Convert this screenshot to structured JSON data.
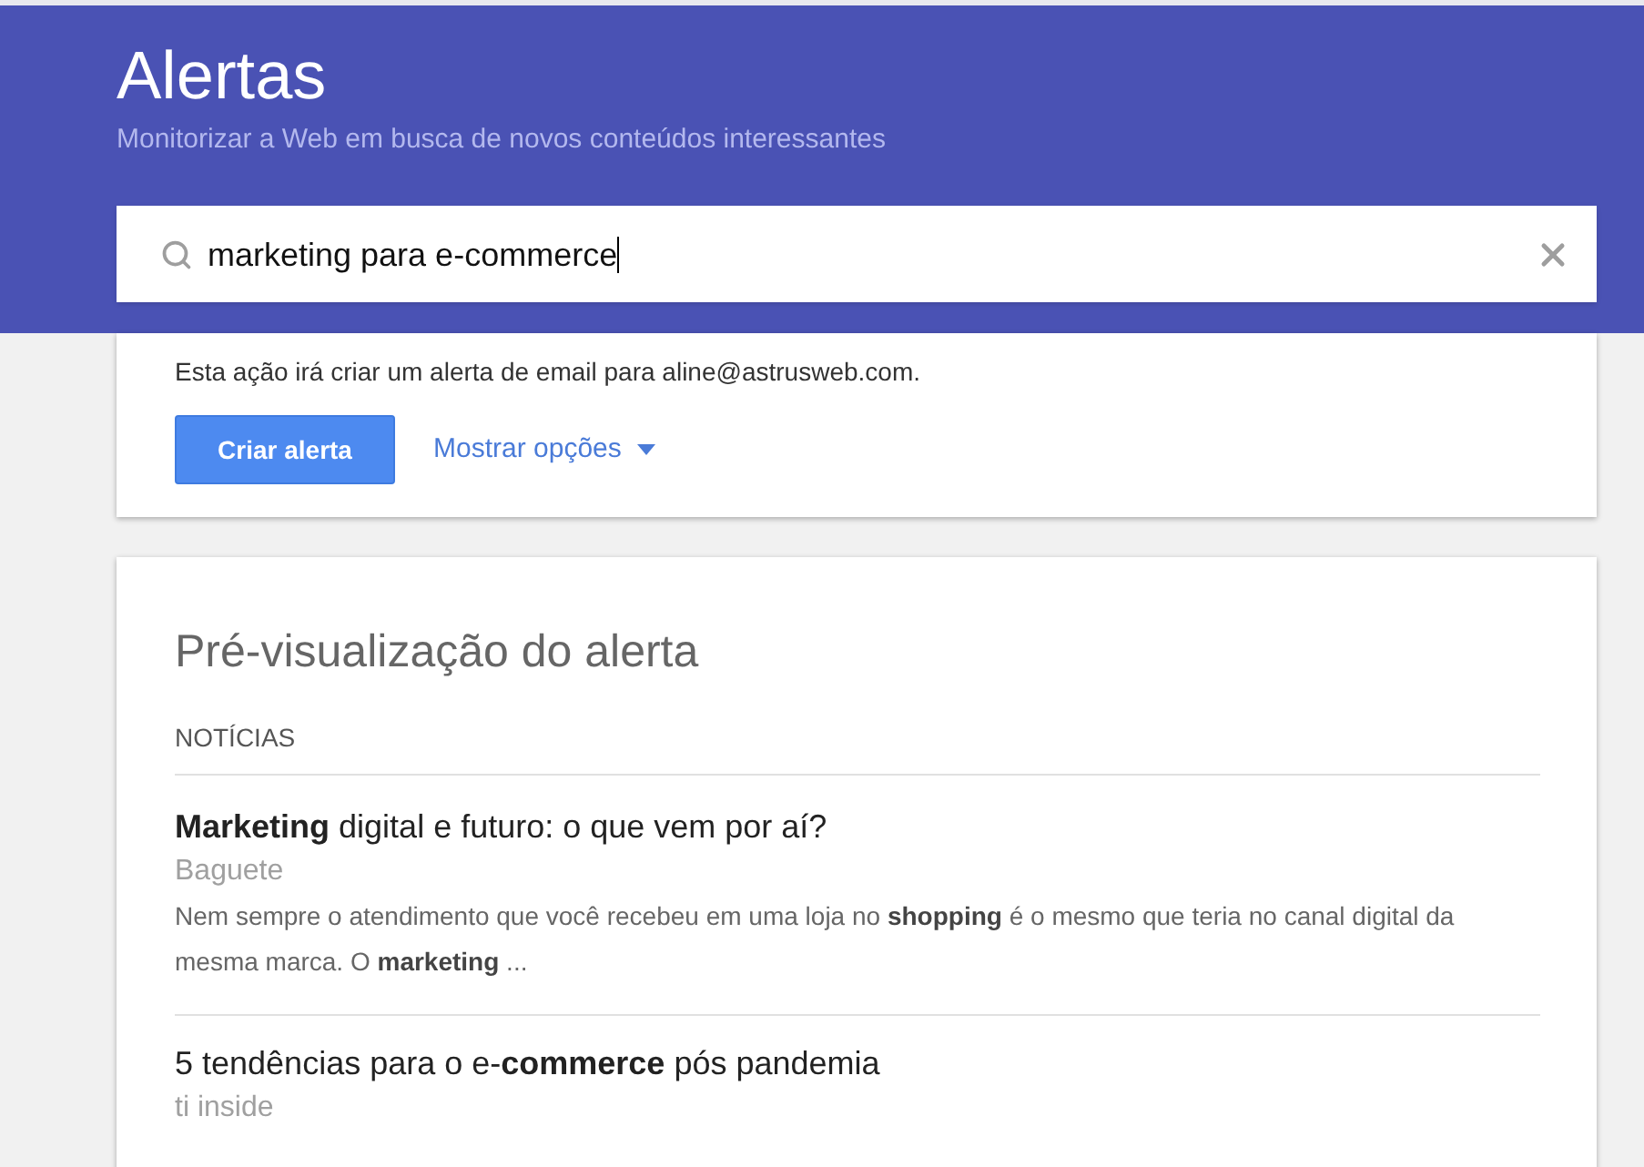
{
  "header": {
    "title": "Alertas",
    "subtitle": "Monitorizar a Web em busca de novos conteúdos interessantes"
  },
  "search": {
    "value": "marketing para e-commerce"
  },
  "create_card": {
    "message": "Esta ação irá criar um alerta de email para aline@astrusweb.com.",
    "create_button": "Criar alerta",
    "options_link": "Mostrar opções"
  },
  "preview": {
    "title": "Pré-visualização do alerta",
    "section": "NOTÍCIAS",
    "items": [
      {
        "title": "**Marketing** digital e futuro: o que vem por aí?",
        "source": "Baguete",
        "snippet": "Nem sempre o atendimento que você recebeu em uma loja no **shopping** é o mesmo que teria no canal digital da mesma marca. O **marketing** ..."
      },
      {
        "title": "5 tendências para o e-**commerce** pós pandemia",
        "source": "ti inside"
      }
    ]
  }
}
